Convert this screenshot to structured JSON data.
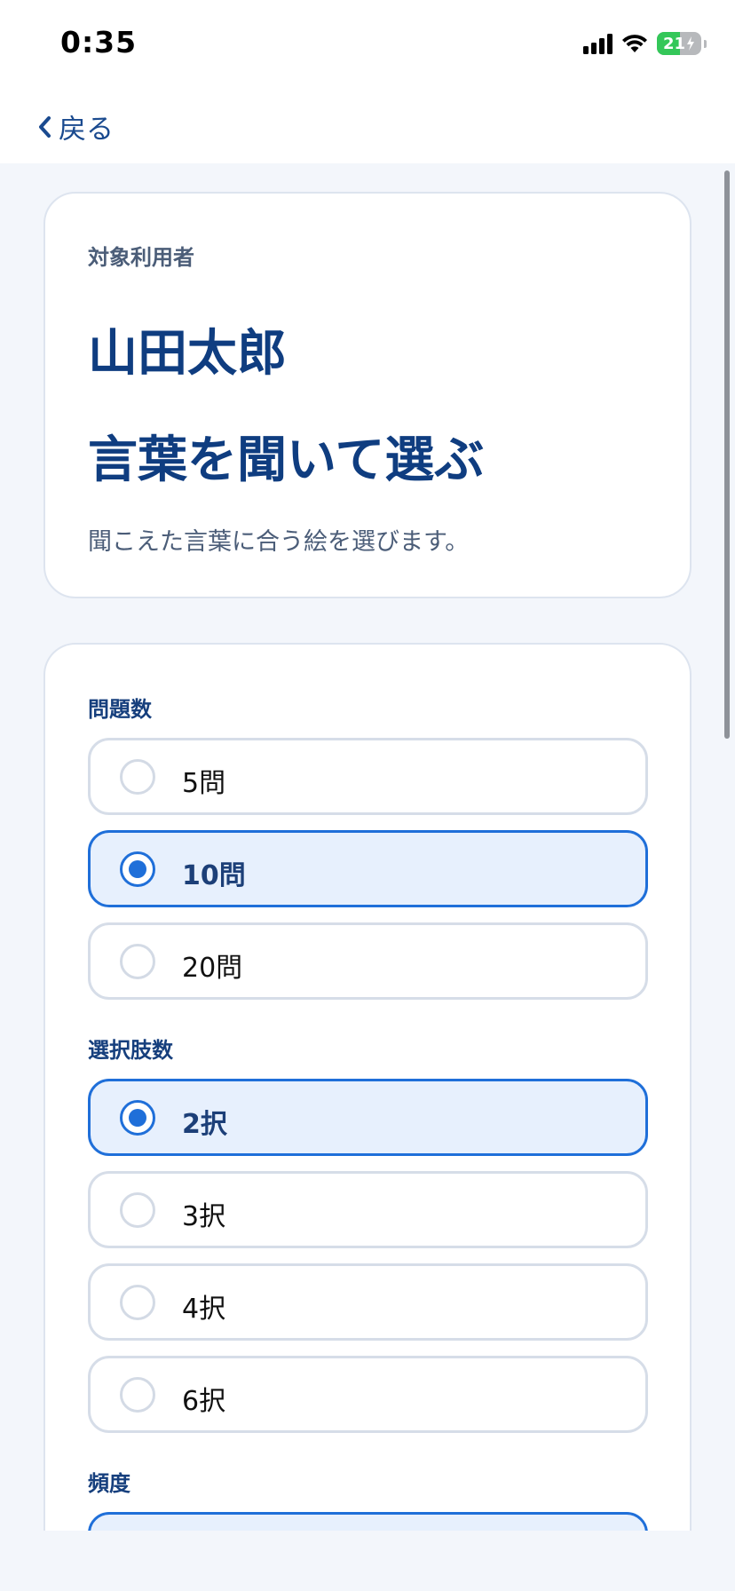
{
  "status_bar": {
    "time": "0:35",
    "battery": "21"
  },
  "nav": {
    "back_label": "戻る"
  },
  "info_card": {
    "subject_label": "対象利用者",
    "user_name": "山田太郎",
    "activity_title": "言葉を聞いて選ぶ",
    "activity_desc": "聞こえた言葉に合う絵を選びます。"
  },
  "settings": {
    "question_count": {
      "label": "問題数",
      "options": [
        {
          "label": "5問",
          "selected": false
        },
        {
          "label": "10問",
          "selected": true
        },
        {
          "label": "20問",
          "selected": false
        }
      ]
    },
    "choice_count": {
      "label": "選択肢数",
      "options": [
        {
          "label": "2択",
          "selected": true
        },
        {
          "label": "3択",
          "selected": false
        },
        {
          "label": "4択",
          "selected": false
        },
        {
          "label": "6択",
          "selected": false
        }
      ]
    },
    "frequency": {
      "label": "頻度"
    }
  },
  "colors": {
    "accent": "#1f6fd9",
    "title": "#0f3d80",
    "selected_bg": "#e7f0fd"
  }
}
